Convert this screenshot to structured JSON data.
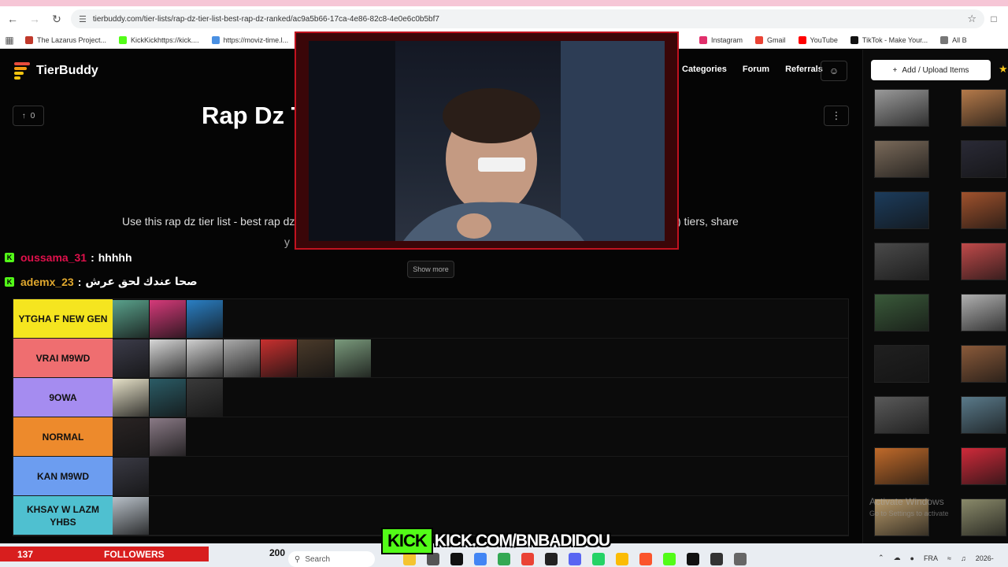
{
  "browser": {
    "url": "tierbuddy.com/tier-lists/rap-dz-tier-list-best-rap-dz-ranked/ac9a5b66-17ca-4e86-82c8-4e0e6c0b5bf7",
    "bookmarks": [
      {
        "label": "The Lazarus Project...",
        "color": "#c0392b"
      },
      {
        "label": "KickKickhttps://kick....",
        "color": "#53fc18"
      },
      {
        "label": "https://moviz-time.l...",
        "color": "#4a90e2"
      }
    ],
    "bookmarks_right": [
      {
        "label": "Instagram",
        "color": "#e1306c"
      },
      {
        "label": "Gmail",
        "color": "#ea4335"
      },
      {
        "label": "YouTube",
        "color": "#ff0000"
      },
      {
        "label": "TikTok - Make Your...",
        "color": "#111111"
      },
      {
        "label": "All B",
        "color": "#777777"
      }
    ]
  },
  "site": {
    "logo": "TierBuddy",
    "nav": [
      "Categories",
      "Forum",
      "Referrals"
    ],
    "upvote_count": "0",
    "title": "Rap Dz T",
    "desc_left": "Use this rap dz tier list - best rap dz",
    "desc_right": ") tiers, share",
    "desc_line2": "y",
    "show_more": "Show more",
    "upload_button": "Add / Upload Items"
  },
  "chat": [
    {
      "user": "oussama_31",
      "user_color": "#e0114c",
      "message": "hhhhh"
    },
    {
      "user": "ademx_23",
      "user_color": "#e0a82e",
      "message": "صحا عندك لحق عرش"
    }
  ],
  "tiers": [
    {
      "label": "YTGHA F NEW GEN",
      "color": "#f5e51f",
      "thumbs": [
        "#5aa28c",
        "#d63a7a",
        "#2a7fc4"
      ]
    },
    {
      "label": "VRAI M9WD",
      "color": "#ef6e70",
      "thumbs": [
        "#3c3c4a",
        "#d7d7d7",
        "#cfcfcf",
        "#aaaaaa",
        "#c8302f",
        "#4a3a2a",
        "#7a9a7c"
      ]
    },
    {
      "label": "9OWA",
      "color": "#a58cf0",
      "thumbs": [
        "#e6e1c8",
        "#2b5c66",
        "#3a3a3a"
      ]
    },
    {
      "label": "NORMAL",
      "color": "#ed8a2c",
      "thumbs": [
        "#2a2424",
        "#8a7a86"
      ]
    },
    {
      "label": "KAN M9WD",
      "color": "#6c9df0",
      "thumbs": [
        "#3a3a44"
      ]
    },
    {
      "label": "KHSAY W LAZM YHBS",
      "color": "#4fc0d0",
      "thumbs": [
        "#b8c0c8"
      ]
    }
  ],
  "sidebar_thumbs": [
    "#9a9a9a",
    "#b57a4a",
    "#7a6a5a",
    "#2a2a36",
    "#1c3c5c",
    "#a0522d",
    "#4a4a4a",
    "#c04a4a",
    "#3a5a3a",
    "#b0b0b0",
    "#202020",
    "#8a5a3a",
    "#5a5a5a",
    "#5a7a8a",
    "#c06a2a",
    "#d02a3a",
    "#b89a6a",
    "#8a8a6a"
  ],
  "stream": {
    "followers_count": "137",
    "followers_label": "FOLLOWERS",
    "kick_badge": "KICK",
    "kick_url": "KICK.COM/BNBADIDOU",
    "taskbar_count": "200",
    "search_placeholder": "Search",
    "tray_lang": "FRA",
    "tray_date": "2026-",
    "activate_windows": "Activate Windows",
    "activate_windows_sub": "Go to Settings to activate"
  }
}
